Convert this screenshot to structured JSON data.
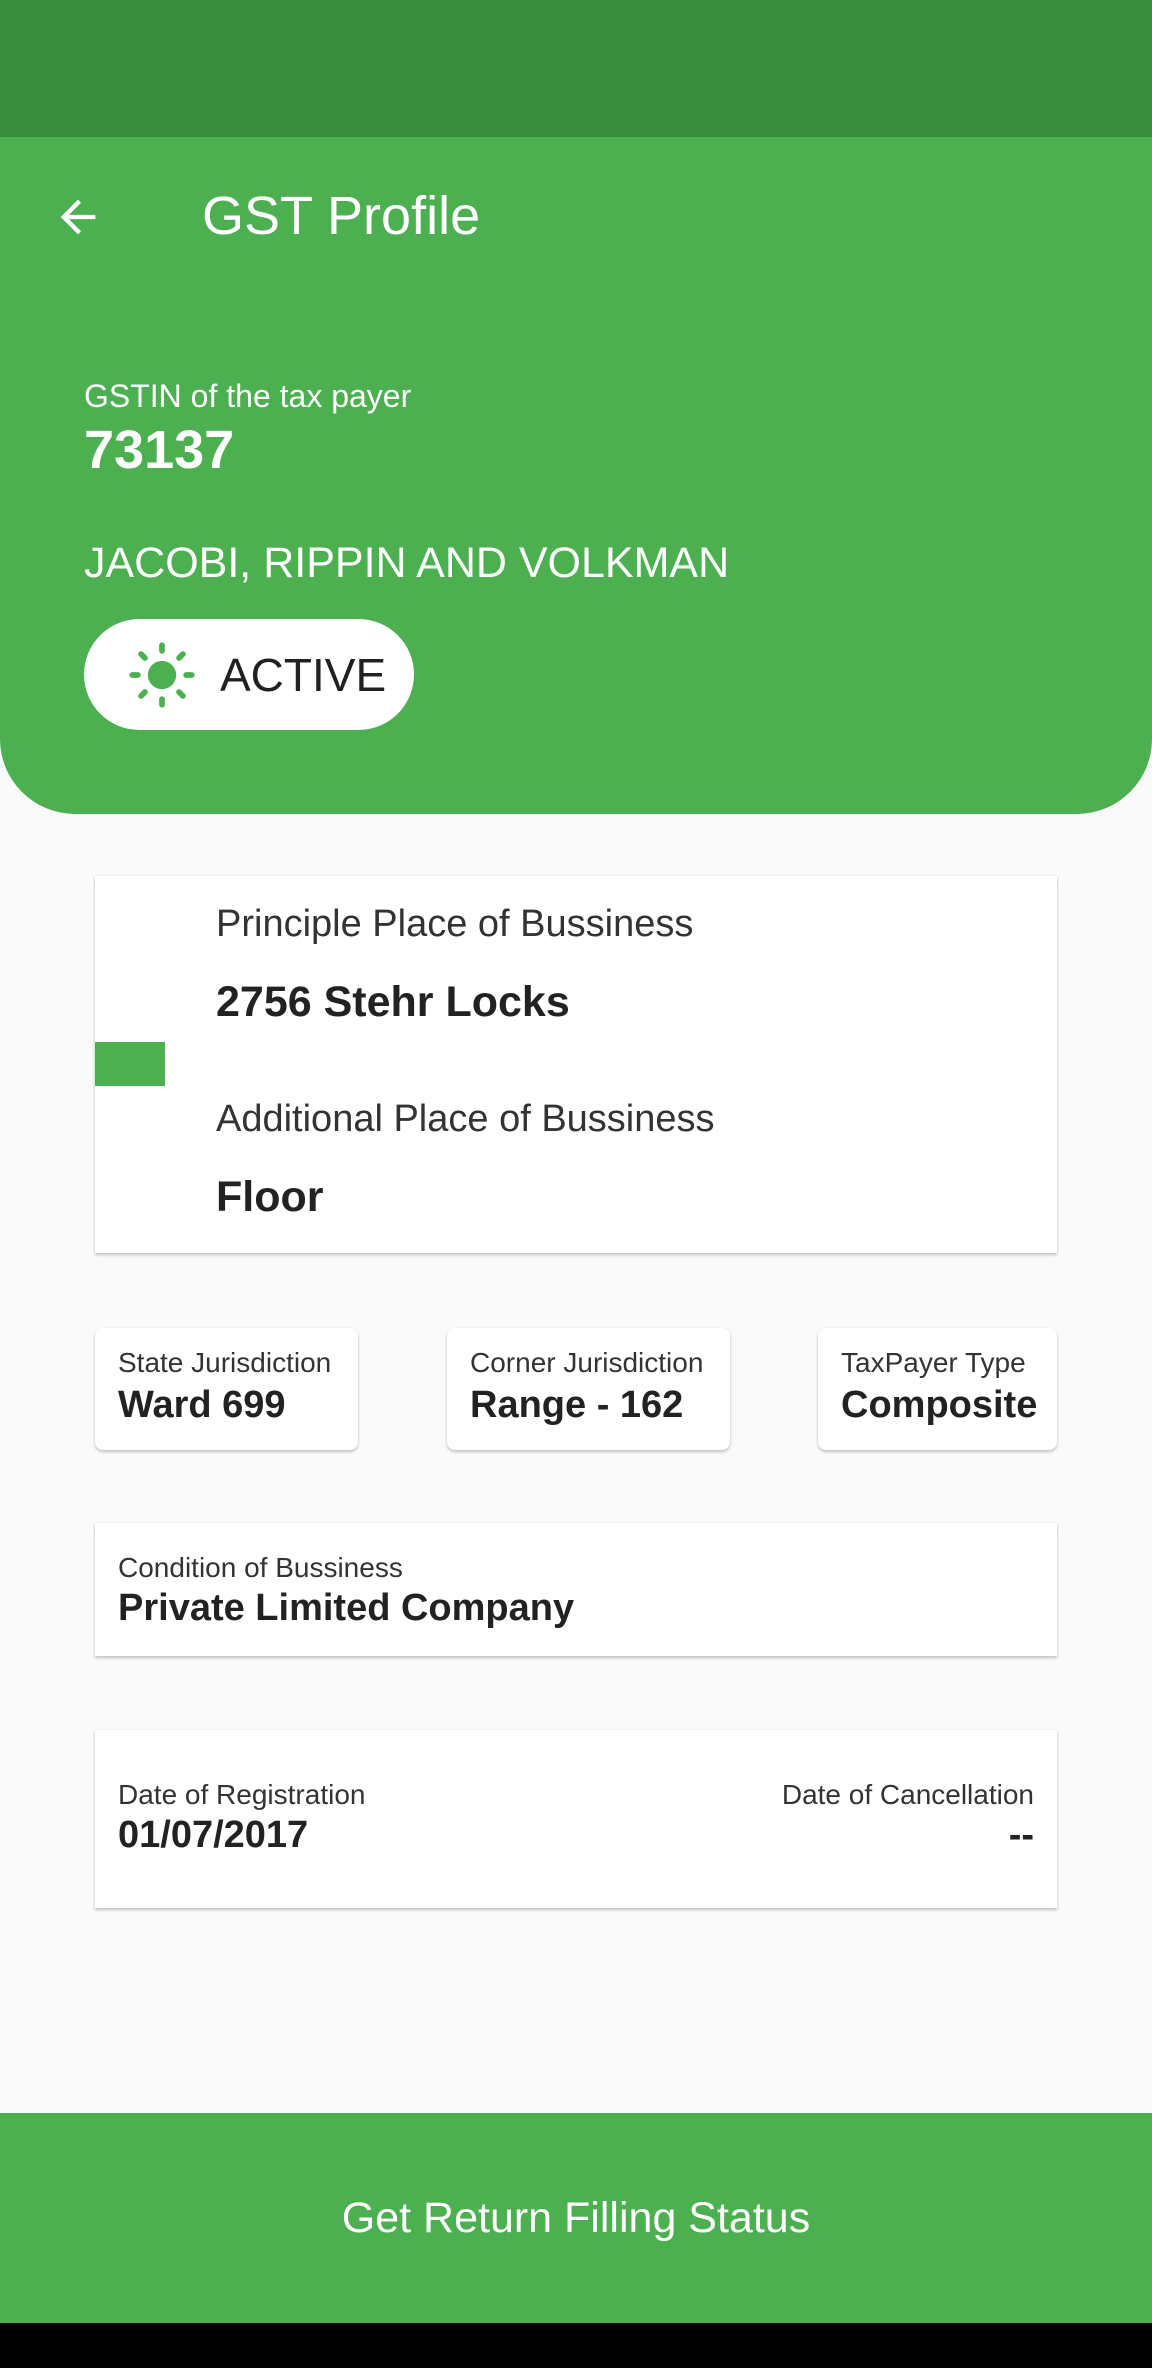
{
  "colors": {
    "primary": "#4CAF50",
    "primary_dark": "#388E3C",
    "background": "#FAFAFA",
    "text_dark": "#222222"
  },
  "app_bar": {
    "back_icon": "arrow-left-icon",
    "title": "GST Profile"
  },
  "profile": {
    "gstin_label": "GSTIN of the tax payer",
    "gstin_value": "73137",
    "business_name": "JACOBI, RIPPIN AND VOLKMAN",
    "status": {
      "icon": "sun-icon",
      "label": "ACTIVE"
    }
  },
  "address": {
    "principal_label": "Principle Place of Bussiness",
    "principal_value": "2756 Stehr Locks",
    "additional_label": "Additional Place of Bussiness",
    "additional_value": "Floor"
  },
  "details": {
    "state_jurisdiction": {
      "label": "State Jurisdiction",
      "value": "Ward 699"
    },
    "corner_jurisdiction": {
      "label": "Corner Jurisdiction",
      "value": "Range - 162"
    },
    "taxpayer_type": {
      "label": "TaxPayer Type",
      "value": "Composite"
    }
  },
  "condition": {
    "label": "Condition of Bussiness",
    "value": "Private Limited Company"
  },
  "dates": {
    "registration_label": "Date of Registration",
    "registration_value": "01/07/2017",
    "cancellation_label": "Date of Cancellation",
    "cancellation_value": "--"
  },
  "actions": {
    "return_status_label": "Get Return Filling Status"
  }
}
